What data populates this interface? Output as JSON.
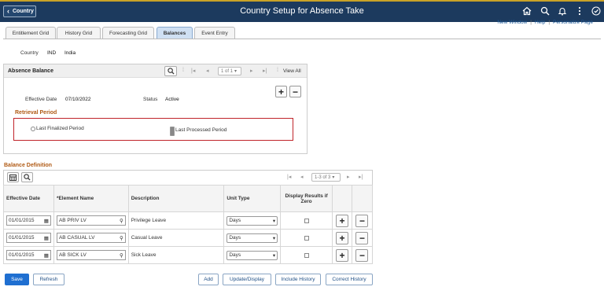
{
  "header": {
    "back_label": "Country",
    "title": "Country Setup for Absence Take",
    "icons": [
      "home-icon",
      "search-icon",
      "bell-icon",
      "more-icon",
      "compass-icon"
    ]
  },
  "top_links": {
    "new_window": "New Window",
    "help": "Help",
    "personalize": "Personalize Page",
    "separator": "|"
  },
  "tabs": [
    {
      "label": "Entitlement Grid",
      "active": false
    },
    {
      "label": "History Grid",
      "active": false
    },
    {
      "label": "Forecasting Grid",
      "active": false
    },
    {
      "label": "Balances",
      "active": true
    },
    {
      "label": "Event Entry",
      "active": false
    }
  ],
  "country": {
    "label": "Country",
    "code": "IND",
    "name": "India"
  },
  "absence_balance": {
    "title": "Absence Balance",
    "pager": "1 of 1",
    "view_all": "View All",
    "effective_date_label": "Effective Date",
    "effective_date": "07/10/2022",
    "status_label": "Status",
    "status": "Active"
  },
  "retrieval": {
    "title": "Retrieval Period",
    "opt1": "Last Finalized Period",
    "opt2": "Last Processed Period",
    "selected": "Last Processed Period"
  },
  "balance_definition": {
    "title": "Balance Definition",
    "pager": "1-3 of 3",
    "headers": [
      "Effective Date",
      "*Element Name",
      "Description",
      "Unit Type",
      "Display Results if Zero"
    ],
    "rows": [
      {
        "date": "01/01/2015",
        "element": "AB PRIV LV",
        "description": "Privilege Leave",
        "unit": "Days"
      },
      {
        "date": "01/01/2015",
        "element": "AB CASUAL LV",
        "description": "Casual Leave",
        "unit": "Days"
      },
      {
        "date": "01/01/2015",
        "element": "AB SICK LV",
        "description": "Sick Leave",
        "unit": "Days"
      }
    ]
  },
  "buttons": {
    "save": "Save",
    "refresh": "Refresh",
    "add": "Add",
    "update_display": "Update/Display",
    "include_history": "Include History",
    "correct_history": "Correct History"
  }
}
